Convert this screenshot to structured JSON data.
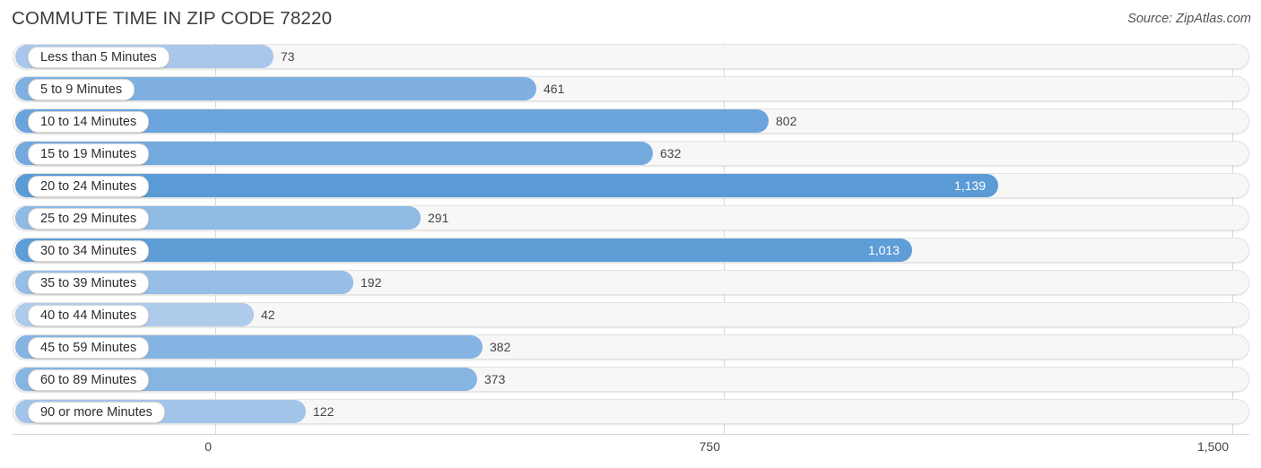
{
  "header": {
    "title": "COMMUTE TIME IN ZIP CODE 78220",
    "source": "Source: ZipAtlas.com"
  },
  "axis": {
    "ticks": [
      {
        "label": "0",
        "value": 0,
        "x": 240
      },
      {
        "label": "750",
        "value": 750,
        "x": 807
      },
      {
        "label": "1,500",
        "value": 1500,
        "x": 1374
      }
    ]
  },
  "colors": {
    "bar_max": "#5b9bd5",
    "bar_min": "#aecbeb",
    "track": "#f7f7f7",
    "track_border": "#e3e3e3",
    "gridline": "#d8d8d8",
    "label_text": "#2e2e33",
    "value_text": "#44444a",
    "value_text_inside": "#ffffff"
  },
  "chart_data": {
    "type": "bar",
    "orientation": "horizontal",
    "title": "COMMUTE TIME IN ZIP CODE 78220",
    "xlabel": "",
    "ylabel": "",
    "xlim": [
      0,
      1500
    ],
    "grid": true,
    "legend": false,
    "source": "Source: ZipAtlas.com",
    "categories": [
      "Less than 5 Minutes",
      "5 to 9 Minutes",
      "10 to 14 Minutes",
      "15 to 19 Minutes",
      "20 to 24 Minutes",
      "25 to 29 Minutes",
      "30 to 34 Minutes",
      "35 to 39 Minutes",
      "40 to 44 Minutes",
      "45 to 59 Minutes",
      "60 to 89 Minutes",
      "90 or more Minutes"
    ],
    "values": [
      73,
      461,
      802,
      632,
      1139,
      291,
      1013,
      192,
      42,
      382,
      373,
      122
    ],
    "value_labels": [
      "73",
      "461",
      "802",
      "632",
      "1,139",
      "291",
      "1,013",
      "192",
      "42",
      "382",
      "373",
      "122"
    ]
  },
  "rows": [
    {
      "label": "Less than 5 Minutes",
      "value": 73,
      "value_label": "73",
      "bar_end": 305,
      "color": "#a9c7ea",
      "inside": false
    },
    {
      "label": "5 to 9 Minutes",
      "value": 461,
      "value_label": "461",
      "bar_end": 598,
      "color": "#7fb0e0",
      "inside": false
    },
    {
      "label": "10 to 14 Minutes",
      "value": 802,
      "value_label": "802",
      "bar_end": 857,
      "color": "#6ba4dc",
      "inside": false
    },
    {
      "label": "15 to 19 Minutes",
      "value": 632,
      "value_label": "632",
      "bar_end": 728,
      "color": "#74a9de",
      "inside": false
    },
    {
      "label": "20 to 24 Minutes",
      "value": 1139,
      "value_label": "1,139",
      "bar_end": 1113,
      "color": "#5b9bd5",
      "inside": true
    },
    {
      "label": "25 to 29 Minutes",
      "value": 291,
      "value_label": "291",
      "bar_end": 469,
      "color": "#8fbae4",
      "inside": false
    },
    {
      "label": "30 to 34 Minutes",
      "value": 1013,
      "value_label": "1,013",
      "bar_end": 1017,
      "color": "#5f9dd7",
      "inside": true
    },
    {
      "label": "35 to 39 Minutes",
      "value": 192,
      "value_label": "192",
      "bar_end": 394,
      "color": "#96bee6",
      "inside": false
    },
    {
      "label": "40 to 44 Minutes",
      "value": 42,
      "value_label": "42",
      "bar_end": 283,
      "color": "#aecbeb",
      "inside": false
    },
    {
      "label": "45 to 59 Minutes",
      "value": 382,
      "value_label": "382",
      "bar_end": 538,
      "color": "#86b4e2",
      "inside": false
    },
    {
      "label": "60 to 89 Minutes",
      "value": 373,
      "value_label": "373",
      "bar_end": 532,
      "color": "#87b5e2",
      "inside": false
    },
    {
      "label": "90 or more Minutes",
      "value": 122,
      "value_label": "122",
      "bar_end": 341,
      "color": "#a3c4e9",
      "inside": false
    }
  ]
}
